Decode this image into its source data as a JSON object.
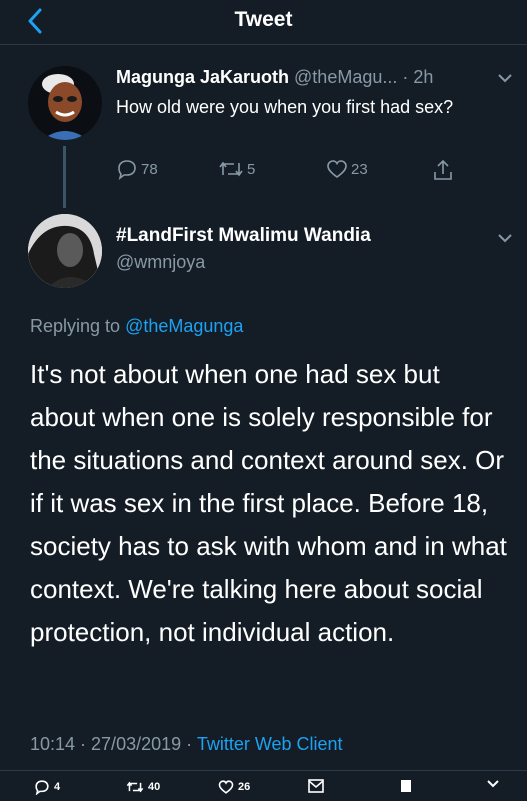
{
  "header": {
    "title": "Tweet"
  },
  "parent_tweet": {
    "author_name": "Magunga JaKaruoth",
    "author_handle": "@theMagu...",
    "time": "· 2h",
    "text": "How old were you when you first had sex?",
    "replies": "78",
    "retweets": "5",
    "likes": "23"
  },
  "reply_tweet": {
    "author_name": "#LandFirst Mwalimu Wandia",
    "author_handle": "@wmnjoya",
    "replying_prefix": "Replying to",
    "replying_to": "@theMagunga",
    "body": "It's not about when one had sex but about when one is solely responsible for the situations and context around sex. Or if it was sex in the first place. Before 18, society has to ask with whom and in what context. We're talking here about social protection, not individual action.",
    "timestamp": "10:14 · 27/03/2019 ·",
    "client": "Twitter Web Client"
  },
  "bottom_actions": {
    "replies": "4",
    "retweets": "40",
    "likes": "26"
  },
  "colors": {
    "background": "#141d26",
    "accent": "#1da1f2",
    "secondary_text": "#8899a6"
  }
}
